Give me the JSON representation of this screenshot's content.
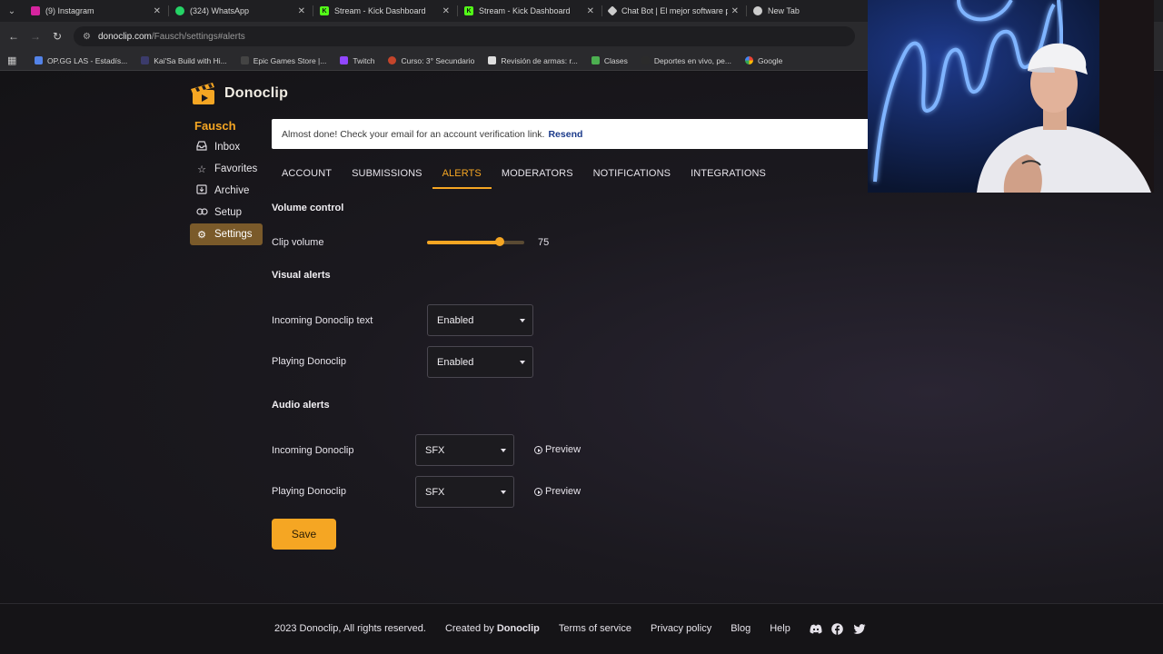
{
  "browser": {
    "tabs": [
      {
        "title": "(9) Instagram",
        "color": "#d6249f"
      },
      {
        "title": "(324) WhatsApp",
        "color": "#25d366"
      },
      {
        "title": "Stream - Kick Dashboard",
        "color": "#53fc18"
      },
      {
        "title": "Stream - Kick Dashboard",
        "color": "#53fc18"
      },
      {
        "title": "Chat Bot | El mejor software pa",
        "color": "#cccccc"
      },
      {
        "title": "New Tab",
        "color": "#cccccc"
      }
    ],
    "url_host": "donoclip.com",
    "url_path": "/Fausch/settings#alerts",
    "bookmarks": [
      {
        "label": "OP.GG LAS - Estadís...",
        "color": "#5383e8"
      },
      {
        "label": "Kai'Sa Build with Hi...",
        "color": "#3b3b6b"
      },
      {
        "label": "Epic Games Store |...",
        "color": "#444444"
      },
      {
        "label": "Twitch",
        "color": "#9146ff"
      },
      {
        "label": "Curso: 3° Secundario",
        "color": "#c4452b"
      },
      {
        "label": "Revisión de armas: r...",
        "color": "#dddddd"
      },
      {
        "label": "Clases",
        "color": "#4caf50"
      },
      {
        "label": "Deportes en vivo, pe...",
        "color": "#2b2b2b"
      },
      {
        "label": "Google",
        "color": "#ffffff"
      }
    ]
  },
  "app": {
    "logo_text": "Donoclip",
    "username": "Fausch",
    "sidebar": [
      {
        "label": "Inbox",
        "icon": "inbox-icon"
      },
      {
        "label": "Favorites",
        "icon": "star-icon"
      },
      {
        "label": "Archive",
        "icon": "archive-icon"
      },
      {
        "label": "Setup",
        "icon": "link-icon"
      },
      {
        "label": "Settings",
        "icon": "gear-icon",
        "active": true
      }
    ],
    "banner": {
      "message": "Almost done! Check your email for an account verification link.",
      "resend": "Resend"
    },
    "tabs": [
      "ACCOUNT",
      "SUBMISSIONS",
      "ALERTS",
      "MODERATORS",
      "NOTIFICATIONS",
      "INTEGRATIONS"
    ],
    "active_tab": "ALERTS",
    "volume_section": "Volume control",
    "clip_volume_label": "Clip volume",
    "clip_volume": 75,
    "visual_section": "Visual alerts",
    "incoming_text_label": "Incoming Donoclip text",
    "incoming_text_value": "Enabled",
    "playing_visual_label": "Playing Donoclip",
    "playing_visual_value": "Enabled",
    "audio_section": "Audio alerts",
    "incoming_audio_label": "Incoming Donoclip",
    "incoming_audio_value": "SFX",
    "playing_audio_label": "Playing Donoclip",
    "playing_audio_value": "SFX",
    "preview_label": "Preview",
    "save_label": "Save",
    "accent": "#f5a623"
  },
  "footer": {
    "copyright": "2023 Donoclip, All rights reserved.",
    "created_by": "Created by",
    "created_brand": "Donoclip",
    "terms": "Terms of service",
    "privacy": "Privacy policy",
    "blog": "Blog",
    "help": "Help",
    "social": [
      "discord-icon",
      "facebook-icon",
      "twitter-icon"
    ]
  }
}
